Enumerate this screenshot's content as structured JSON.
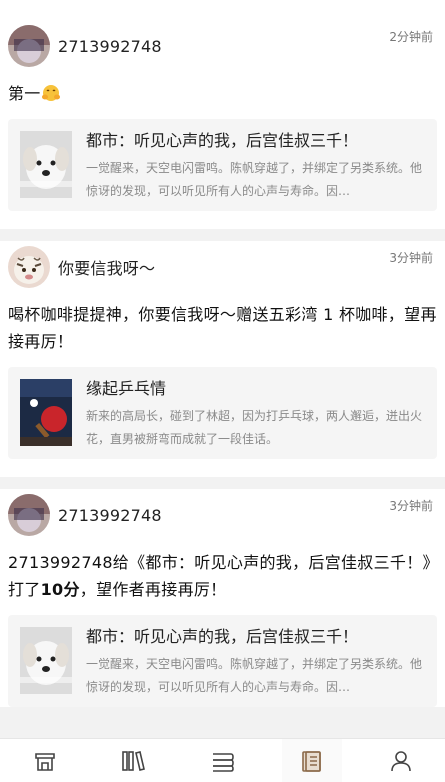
{
  "posts": [
    {
      "username": "2713992748",
      "time": "2分钟前",
      "text": "第一",
      "emoji": "hug-emoji",
      "book": {
        "title": "都市：听见心声的我，后宫佳叔三千！",
        "desc": "一觉醒来，天空电闪雷鸣。陈帆穿越了，并绑定了另类系统。他惊讶的发现，可以听见所有人的心声与寿命。因…"
      }
    },
    {
      "username": "你要信我呀～",
      "time": "3分钟前",
      "text": "喝杯咖啡提提神，你要信我呀～赠送五彩湾 1 杯咖啡，望再接再厉！",
      "book": {
        "title": "缘起乒乓情",
        "desc": "新来的高局长，碰到了林超，因为打乒乓球，两人邂逅，迸出火花，直男被掰弯而成就了一段佳话。"
      }
    },
    {
      "username": "2713992748",
      "time": "3分钟前",
      "text_pre": "2713992748给《都市：听见心声的我，后宫佳叔三千！》打了",
      "text_score": "10分",
      "text_post": "，望作者再接再厉！",
      "book": {
        "title": "都市：听见心声的我，后宫佳叔三千！",
        "desc": "一觉醒来，天空电闪雷鸣。陈帆穿越了，并绑定了另类系统。他惊讶的发现，可以听见所有人的心声与寿命。因…"
      }
    }
  ],
  "tabbar": {
    "items": [
      {
        "icon": "bookstore-icon"
      },
      {
        "icon": "library-icon"
      },
      {
        "icon": "category-icon"
      },
      {
        "icon": "feed-icon",
        "active": true
      },
      {
        "icon": "profile-icon"
      }
    ]
  },
  "colors": {
    "background": "#f2f2f2",
    "card": "#f5f5f5",
    "muted": "#8a8a8a"
  }
}
